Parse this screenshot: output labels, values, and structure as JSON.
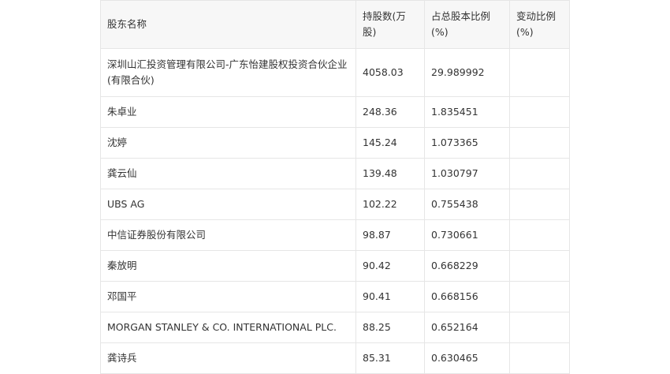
{
  "table": {
    "headers": [
      "股东名称",
      "持股数(万股)",
      "占总股本比例(%)",
      "变动比例(%)"
    ],
    "rows": [
      {
        "name": "深圳山汇投资管理有限公司-广东怡建股权投资合伙企业(有限合伙)",
        "shares": "4058.03",
        "ratio": "29.989992",
        "change": ""
      },
      {
        "name": "朱卓业",
        "shares": "248.36",
        "ratio": "1.835451",
        "change": ""
      },
      {
        "name": "沈婷",
        "shares": "145.24",
        "ratio": "1.073365",
        "change": ""
      },
      {
        "name": "龚云仙",
        "shares": "139.48",
        "ratio": "1.030797",
        "change": ""
      },
      {
        "name": "UBS AG",
        "shares": "102.22",
        "ratio": "0.755438",
        "change": ""
      },
      {
        "name": "中信证券股份有限公司",
        "shares": "98.87",
        "ratio": "0.730661",
        "change": ""
      },
      {
        "name": "秦放明",
        "shares": "90.42",
        "ratio": "0.668229",
        "change": ""
      },
      {
        "name": "邓国平",
        "shares": "90.41",
        "ratio": "0.668156",
        "change": ""
      },
      {
        "name": "MORGAN STANLEY & CO. INTERNATIONAL PLC.",
        "shares": "88.25",
        "ratio": "0.652164",
        "change": ""
      },
      {
        "name": "龚诗兵",
        "shares": "85.31",
        "ratio": "0.630465",
        "change": ""
      }
    ]
  }
}
